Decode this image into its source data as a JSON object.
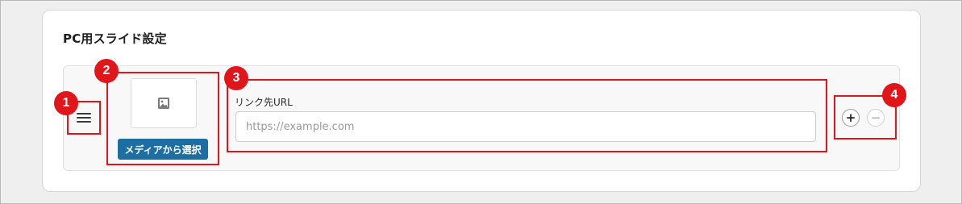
{
  "settings": {
    "title": "PC用スライド設定"
  },
  "slide_row": {
    "media_button_label": "メディアから選択",
    "url_label": "リンク先URL",
    "url_value": "",
    "url_placeholder": "https://example.com",
    "add_symbol": "+",
    "remove_symbol": "−"
  },
  "callouts": [
    "1",
    "2",
    "3",
    "4"
  ],
  "colors": {
    "accent": "#1d6fa3",
    "callout": "#e0161b"
  },
  "icons": {
    "drag": "drag-handle-icon",
    "image": "image-placeholder-icon"
  }
}
